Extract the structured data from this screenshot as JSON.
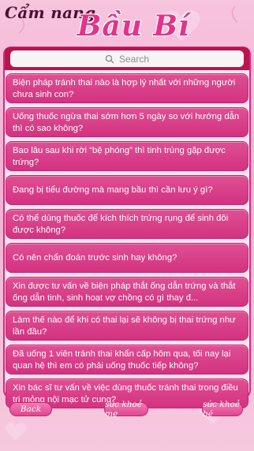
{
  "header": {
    "brand_small": "Cẩm nang",
    "brand_big": "Bầu Bí"
  },
  "search": {
    "placeholder": "Search"
  },
  "questions": [
    "Biện pháp tránh thai nào là hợp lý nhất với những người chưa sinh con?",
    "Uống thuốc ngừa thai sớm hơn 5 ngày so với hướng dẫn thì có sao không?",
    "Bao lâu sau khi rời “bệ phóng” thì tinh trùng gặp được trứng?",
    "Đang bị tiểu đường mà mang bầu thì cần lưu ý gì?",
    "Có thể dùng thuốc để kích thích trứng rụng để sinh đôi được không?",
    "Có nên chẩn đoán trước sinh hay không?",
    "Xin được tư vấn về biện pháp thắt ống dẫn trứng và thắt ống dẫn tinh, sinh hoạt vợ chồng có gì thay đ...",
    "Làm thế nào để khi có thai lại sẽ không bị thai trứng như lần đầu?",
    "Đã uống 1 viên tránh thai khẩn cấp hôm qua, tối nay lại quan hệ thì em có phải uống thuốc tiếp không?",
    "Xin bác sĩ tư vấn về việc dùng thuốc tránh thai trong điều trị mỏng nội mạc tử cung?"
  ],
  "footer": {
    "back_label": "Back",
    "mother_label": "sức khoẻ mẹ",
    "baby_label": "sức khoẻ bé"
  },
  "colors": {
    "accent": "#d33280",
    "dark_accent": "#b9144f"
  }
}
